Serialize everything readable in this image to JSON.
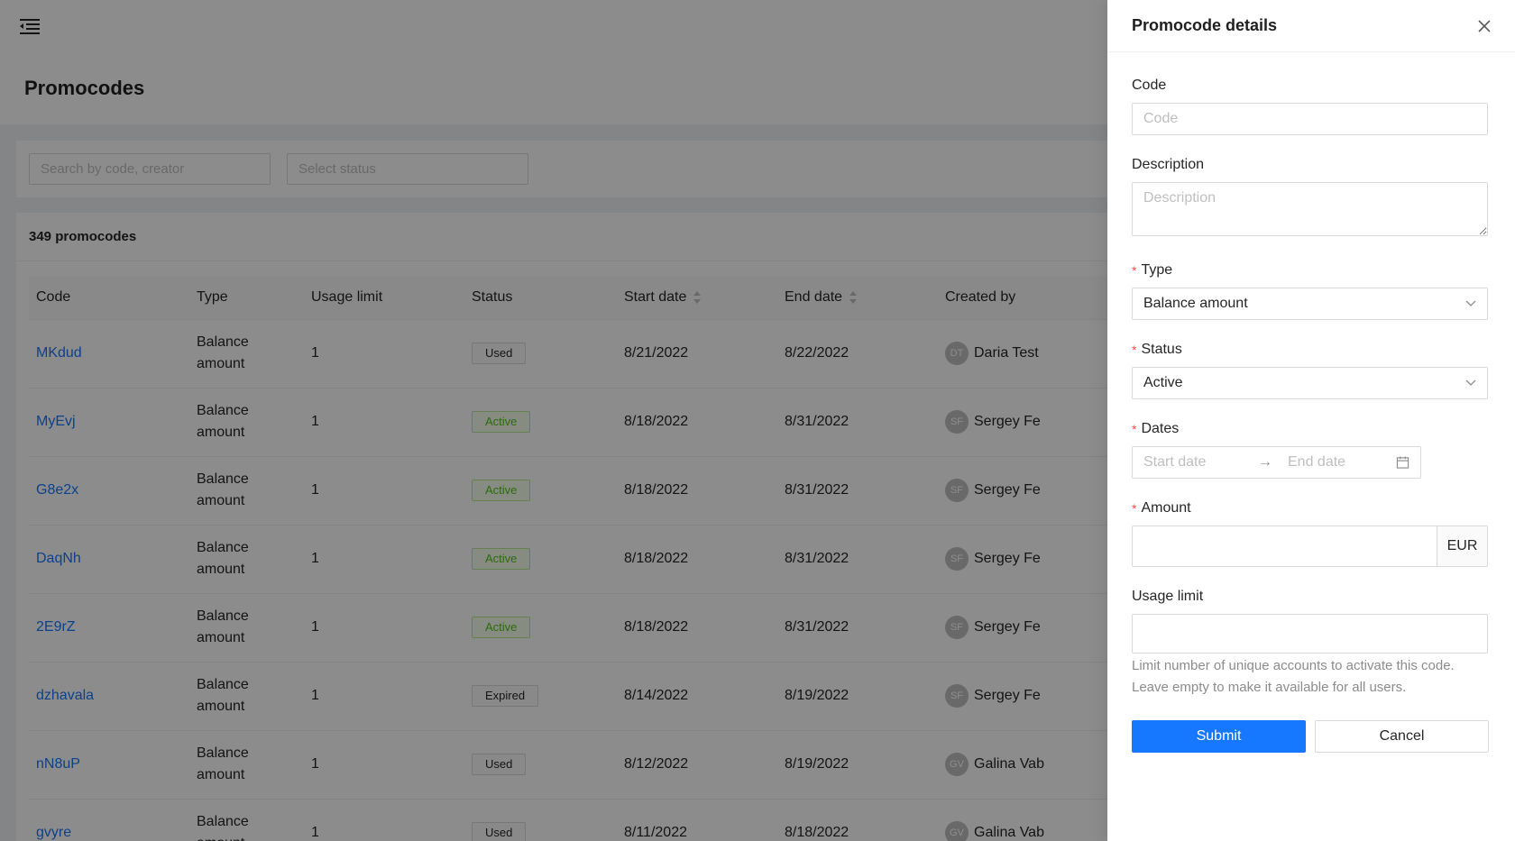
{
  "page": {
    "title": "Promocodes",
    "search_placeholder": "Search by code, creator",
    "status_placeholder": "Select status",
    "count_text": "349 promocodes"
  },
  "table": {
    "columns": [
      "Code",
      "Type",
      "Usage limit",
      "Status",
      "Start date",
      "End date",
      "Created by"
    ],
    "rows": [
      {
        "code": "MKdud",
        "type_line1": "Balance",
        "type_line2": "amount",
        "usage": "1",
        "status": "Used",
        "start": "8/21/2022",
        "end": "8/22/2022",
        "initials": "DT",
        "creator": "Daria Test"
      },
      {
        "code": "MyEvj",
        "type_line1": "Balance",
        "type_line2": "amount",
        "usage": "1",
        "status": "Active",
        "start": "8/18/2022",
        "end": "8/31/2022",
        "initials": "SF",
        "creator": "Sergey Fe"
      },
      {
        "code": "G8e2x",
        "type_line1": "Balance",
        "type_line2": "amount",
        "usage": "1",
        "status": "Active",
        "start": "8/18/2022",
        "end": "8/31/2022",
        "initials": "SF",
        "creator": "Sergey Fe"
      },
      {
        "code": "DaqNh",
        "type_line1": "Balance",
        "type_line2": "amount",
        "usage": "1",
        "status": "Active",
        "start": "8/18/2022",
        "end": "8/31/2022",
        "initials": "SF",
        "creator": "Sergey Fe"
      },
      {
        "code": "2E9rZ",
        "type_line1": "Balance",
        "type_line2": "amount",
        "usage": "1",
        "status": "Active",
        "start": "8/18/2022",
        "end": "8/31/2022",
        "initials": "SF",
        "creator": "Sergey Fe"
      },
      {
        "code": "dzhavala",
        "type_line1": "Balance",
        "type_line2": "amount",
        "usage": "1",
        "status": "Expired",
        "start": "8/14/2022",
        "end": "8/19/2022",
        "initials": "SF",
        "creator": "Sergey Fe"
      },
      {
        "code": "nN8uP",
        "type_line1": "Balance",
        "type_line2": "amount",
        "usage": "1",
        "status": "Used",
        "start": "8/12/2022",
        "end": "8/19/2022",
        "initials": "GV",
        "creator": "Galina Vab"
      },
      {
        "code": "gvyre",
        "type_line1": "Balance",
        "type_line2": "amount",
        "usage": "1",
        "status": "Used",
        "start": "8/11/2022",
        "end": "8/18/2022",
        "initials": "GV",
        "creator": "Galina Vab"
      }
    ]
  },
  "drawer": {
    "title": "Promocode details",
    "code_label": "Code",
    "code_placeholder": "Code",
    "description_label": "Description",
    "description_placeholder": "Description",
    "type_label": "Type",
    "type_value": "Balance amount",
    "status_label": "Status",
    "status_value": "Active",
    "dates_label": "Dates",
    "start_placeholder": "Start date",
    "end_placeholder": "End date",
    "amount_label": "Amount",
    "amount_currency": "EUR",
    "usage_label": "Usage limit",
    "usage_help": "Limit number of unique accounts to activate this code. Leave empty to make it available for all users.",
    "submit_label": "Submit",
    "cancel_label": "Cancel"
  },
  "colors": {
    "primary": "#1677ff",
    "active_tag": "#52c41a",
    "required": "#ff4d4f"
  }
}
